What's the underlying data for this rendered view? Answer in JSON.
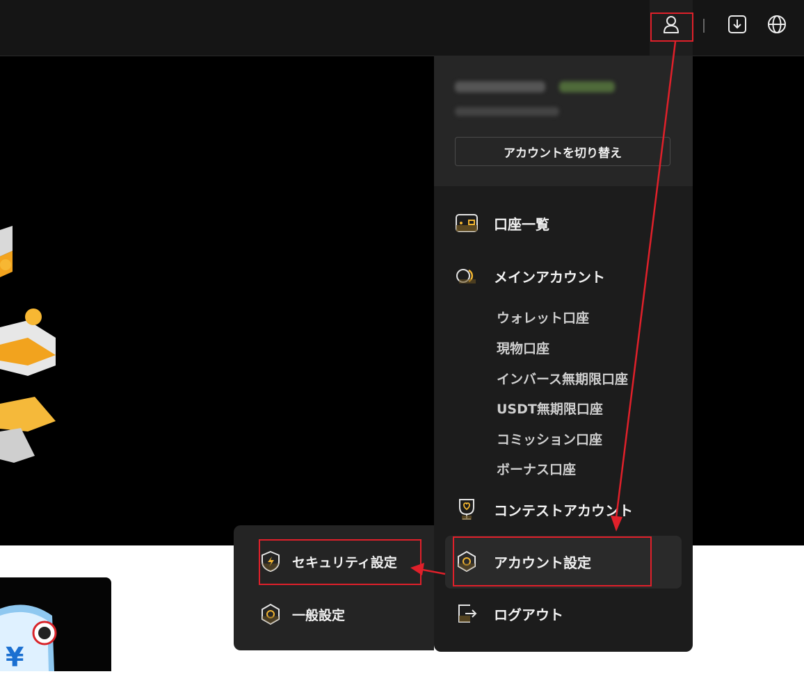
{
  "header": {
    "icons": [
      "user-icon",
      "download-icon",
      "globe-icon"
    ]
  },
  "account_menu": {
    "switch_account_label": "アカウントを切り替え",
    "items": [
      {
        "label": "口座一覧",
        "icon": "wallet-icon"
      },
      {
        "label": "メインアカウント",
        "icon": "main-account-icon"
      },
      {
        "label": "コンテストアカウント",
        "icon": "trophy-icon"
      },
      {
        "label": "アカウント設定",
        "icon": "hexagon-settings-icon"
      },
      {
        "label": "ログアウト",
        "icon": "logout-icon"
      }
    ],
    "sub_accounts": [
      "ウォレット口座",
      "現物口座",
      "インバース無期限口座",
      "USDT無期限口座",
      "コミッション口座",
      "ボーナス口座"
    ]
  },
  "settings_submenu": {
    "items": [
      {
        "label": "セキュリティ設定",
        "icon": "shield-lightning-icon"
      },
      {
        "label": "一般設定",
        "icon": "hexagon-icon"
      }
    ]
  },
  "colors": {
    "accent": "#f2b530",
    "annotation": "#e0202a",
    "vip_badge": "#7bc043"
  }
}
